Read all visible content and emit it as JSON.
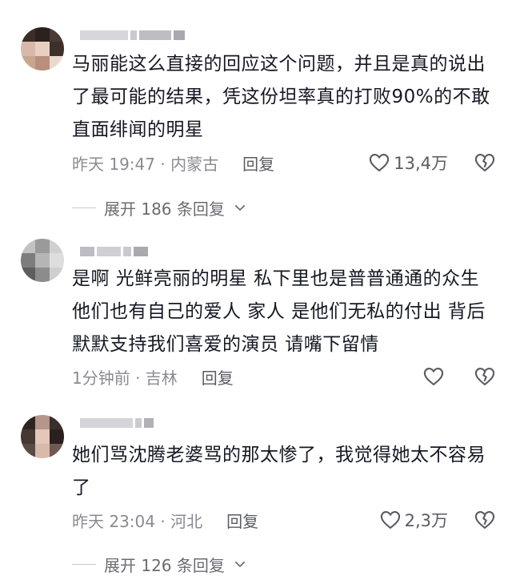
{
  "comments": [
    {
      "text": "马丽能这么直接的回应这个问题，并且是真的说出了最可能的结果，凭这份坦率真的打败90%的不敢直面绯闻的明星",
      "time_location": "昨天 19:47 · 内蒙古",
      "reply_label": "回复",
      "likes": "13,4万",
      "expand_label": "展开 186 条回复"
    },
    {
      "text": "是啊 光鲜亮丽的明星 私下里也是普普通通的众生 他们也有自己的爱人 家人 是他们无私的付出 背后默默支持我们喜爱的演员 请嘴下留情",
      "time_location": "1分钟前 · 吉林",
      "reply_label": "回复",
      "likes": "",
      "expand_label": ""
    },
    {
      "text": "她们骂沈腾老婆骂的那太惨了，我觉得她太不容易了",
      "time_location": "昨天 23:04 · 河北",
      "reply_label": "回复",
      "likes": "2,3万",
      "expand_label": "展开 126 条回复"
    }
  ],
  "colors": {
    "text": "#161823",
    "meta": "#8a8b91",
    "background": "#ffffff"
  },
  "icons": [
    "heart-icon",
    "broken-heart-icon",
    "chevron-down-icon"
  ]
}
